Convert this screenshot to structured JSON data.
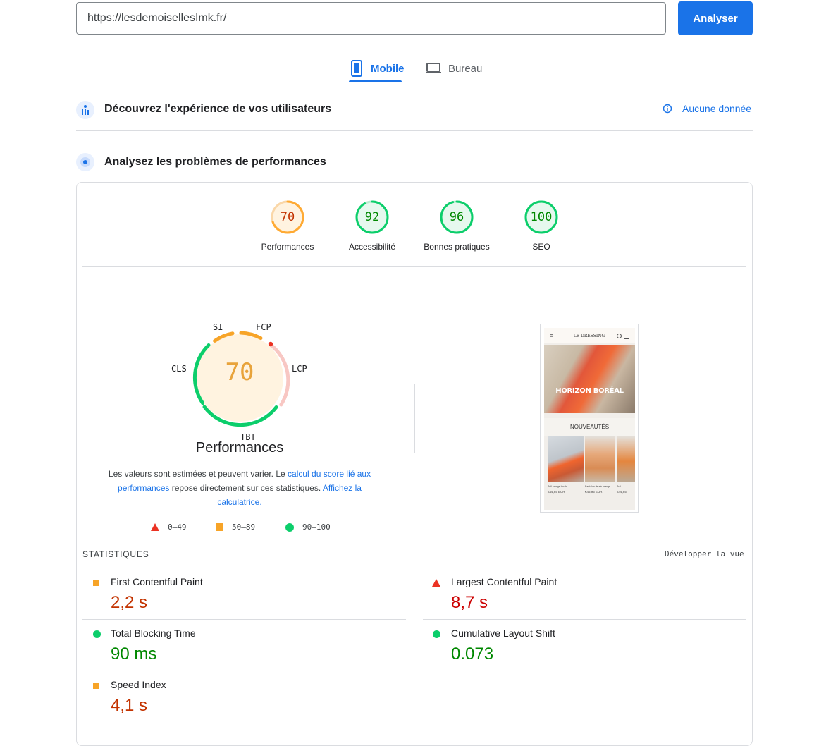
{
  "search": {
    "url_value": "https://lesdemoisellesImk.fr/",
    "analyze_label": "Analyser"
  },
  "tabs": [
    {
      "label": "Mobile",
      "icon": "smartphone-icon",
      "active": true
    },
    {
      "label": "Bureau",
      "icon": "laptop-icon",
      "active": false
    }
  ],
  "user_experience": {
    "title": "Découvrez l'expérience de vos utilisateurs",
    "no_data_label": "Aucune donnée"
  },
  "diagnose": {
    "title": "Analysez les problèmes de performances"
  },
  "scores": [
    {
      "label": "Performances",
      "value": 70,
      "color": "#fa3"
    },
    {
      "label": "Accessibilité",
      "value": 92,
      "color": "#0cce6b"
    },
    {
      "label": "Bonnes pratiques",
      "value": 96,
      "color": "#0cce6b"
    },
    {
      "label": "SEO",
      "value": 100,
      "color": "#0cce6b"
    }
  ],
  "main_gauge": {
    "score": 70,
    "title": "Performances",
    "metric_tags": {
      "si": "SI",
      "fcp": "FCP",
      "lcp": "LCP",
      "tbt": "TBT",
      "cls": "CLS"
    },
    "disclaimer_start": "Les valeurs sont estimées et peuvent varier. Le ",
    "disclaimer_link1": "calcul du score lié aux performances",
    "disclaimer_middle": " repose directement sur ces statistiques. ",
    "disclaimer_link2": "Affichez la calculatrice."
  },
  "legend": [
    {
      "range": "0–49",
      "shape": "triangle",
      "color": "#eb3223"
    },
    {
      "range": "50–89",
      "shape": "square",
      "color": "#f7a428"
    },
    {
      "range": "90–100",
      "shape": "circle",
      "color": "#0cce6b"
    }
  ],
  "stats": {
    "label": "STATISTIQUES",
    "expand_label": "Développer la vue",
    "metrics": [
      {
        "name": "First Contentful Paint",
        "value": "2,2 s",
        "rating": "average"
      },
      {
        "name": "Largest Contentful Paint",
        "value": "8,7 s",
        "rating": "fail"
      },
      {
        "name": "Total Blocking Time",
        "value": "90 ms",
        "rating": "pass"
      },
      {
        "name": "Cumulative Layout Shift",
        "value": "0.073",
        "rating": "pass"
      },
      {
        "name": "Speed Index",
        "value": "4,1 s",
        "rating": "average"
      }
    ]
  },
  "screenshot": {
    "brand": "LE DRESSING",
    "hero_text": "HORIZON BORÉAL",
    "section": "NOUVEAUTÉS",
    "products": [
      {
        "name": "Pull orange Isnab",
        "price": "€44,95 EUR"
      },
      {
        "name": "Pantalon fleuris orange",
        "price": "€46,95 EUR"
      },
      {
        "name": "Pull",
        "price": "€44,95"
      }
    ]
  }
}
